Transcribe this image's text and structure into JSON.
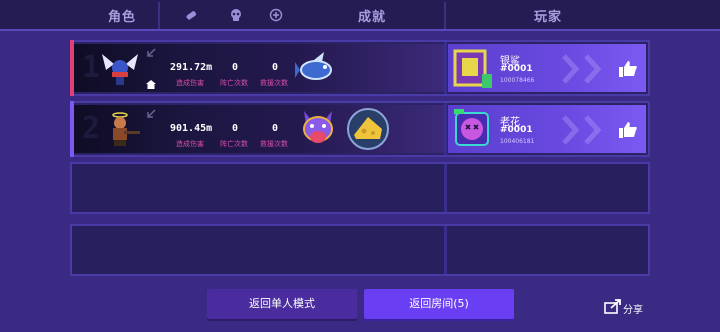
{
  "header": {
    "col_role": "角色",
    "col_achievement": "成就",
    "col_player": "玩家",
    "icons": [
      "bandage-icon",
      "skull-icon",
      "plus-circle-icon"
    ]
  },
  "rows": [
    {
      "rank": "1",
      "accent_color": "#e0407a",
      "damage": "291.72m",
      "deaths": "0",
      "revives": "0",
      "damage_label": "造成伤害",
      "deaths_label": "阵亡次数",
      "revives_label": "救援次数",
      "badges": [
        "fish-badge-icon"
      ],
      "player": {
        "name": "银鲨",
        "tag": "#0001",
        "id": "100078466"
      }
    },
    {
      "rank": "2",
      "accent_color": "#7a5af0",
      "damage": "901.45m",
      "deaths": "0",
      "revives": "0",
      "damage_label": "造成伤害",
      "deaths_label": "阵亡次数",
      "revives_label": "救援次数",
      "badges": [
        "wolf-badge-icon",
        "cheese-badge-icon"
      ],
      "player": {
        "name": "老花",
        "tag": "#0001",
        "id": "100406181"
      }
    }
  ],
  "buttons": {
    "single": "返回单人模式",
    "room": "返回房间(5)",
    "share": "分享"
  }
}
